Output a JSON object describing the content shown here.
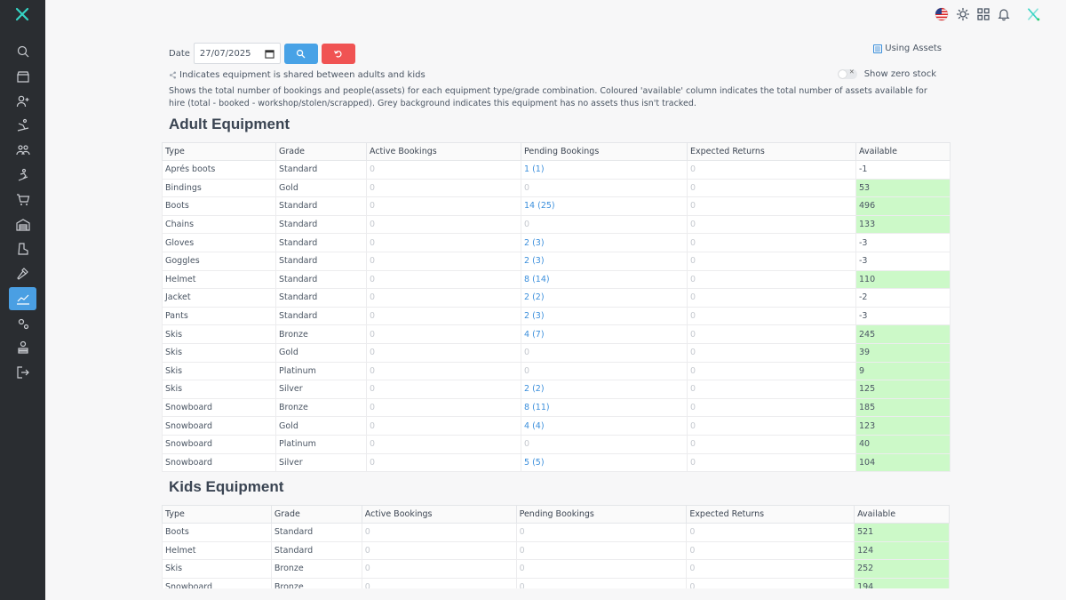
{
  "topbar": {
    "icons": [
      "us-flag-icon",
      "sun-icon",
      "grid-icon",
      "bell-icon",
      "brand-logo-icon"
    ]
  },
  "sidebar": {
    "items": [
      {
        "name": "search-icon"
      },
      {
        "name": "shop-icon"
      },
      {
        "name": "add-user-icon"
      },
      {
        "name": "skier-icon"
      },
      {
        "name": "group-icon"
      },
      {
        "name": "snowboarder-icon"
      },
      {
        "name": "cart-icon"
      },
      {
        "name": "warehouse-icon"
      },
      {
        "name": "boot-icon"
      },
      {
        "name": "hammer-icon"
      },
      {
        "name": "chart-icon",
        "active": true
      },
      {
        "name": "settings-icon"
      },
      {
        "name": "user-stack-icon"
      },
      {
        "name": "logout-icon"
      }
    ]
  },
  "filter": {
    "date_label": "Date",
    "date_value": "27/07/2025"
  },
  "using_assets": {
    "icon_text": "▥",
    "label": "Using Assets"
  },
  "shared_note": "Indicates equipment is shared between adults and kids",
  "zero_stock": {
    "label": "Show zero stock",
    "toggle_mark": "✕"
  },
  "description": "Shows the total number of bookings and people(assets) for each equipment type/grade combination. Coloured 'available' column indicates the total number of assets available for hire (total - booked - workshop/stolen/scrapped). Grey background indicates this equipment has no assets thus isn't tracked.",
  "adult": {
    "title": "Adult Equipment",
    "columns": [
      "Type",
      "Grade",
      "Active Bookings",
      "Pending Bookings",
      "Expected Returns",
      "Available"
    ],
    "rows": [
      {
        "type": "Aprés boots",
        "grade": "Standard",
        "active": "0",
        "pending": "1 (1)",
        "returns": "0",
        "available": "-1"
      },
      {
        "type": "Bindings",
        "grade": "Gold",
        "active": "0",
        "pending": "0",
        "returns": "0",
        "available": "53"
      },
      {
        "type": "Boots",
        "grade": "Standard",
        "active": "0",
        "pending": "14 (25)",
        "returns": "0",
        "available": "496"
      },
      {
        "type": "Chains",
        "grade": "Standard",
        "active": "0",
        "pending": "0",
        "returns": "0",
        "available": "133"
      },
      {
        "type": "Gloves",
        "grade": "Standard",
        "active": "0",
        "pending": "2 (3)",
        "returns": "0",
        "available": "-3"
      },
      {
        "type": "Goggles",
        "grade": "Standard",
        "active": "0",
        "pending": "2 (3)",
        "returns": "0",
        "available": "-3"
      },
      {
        "type": "Helmet",
        "grade": "Standard",
        "active": "0",
        "pending": "8 (14)",
        "returns": "0",
        "available": "110"
      },
      {
        "type": "Jacket",
        "grade": "Standard",
        "active": "0",
        "pending": "2 (2)",
        "returns": "0",
        "available": "-2"
      },
      {
        "type": "Pants",
        "grade": "Standard",
        "active": "0",
        "pending": "2 (3)",
        "returns": "0",
        "available": "-3"
      },
      {
        "type": "Skis",
        "grade": "Bronze",
        "active": "0",
        "pending": "4 (7)",
        "returns": "0",
        "available": "245"
      },
      {
        "type": "Skis",
        "grade": "Gold",
        "active": "0",
        "pending": "0",
        "returns": "0",
        "available": "39"
      },
      {
        "type": "Skis",
        "grade": "Platinum",
        "active": "0",
        "pending": "0",
        "returns": "0",
        "available": "9"
      },
      {
        "type": "Skis",
        "grade": "Silver",
        "active": "0",
        "pending": "2 (2)",
        "returns": "0",
        "available": "125"
      },
      {
        "type": "Snowboard",
        "grade": "Bronze",
        "active": "0",
        "pending": "8 (11)",
        "returns": "0",
        "available": "185"
      },
      {
        "type": "Snowboard",
        "grade": "Gold",
        "active": "0",
        "pending": "4 (4)",
        "returns": "0",
        "available": "123"
      },
      {
        "type": "Snowboard",
        "grade": "Platinum",
        "active": "0",
        "pending": "0",
        "returns": "0",
        "available": "40"
      },
      {
        "type": "Snowboard",
        "grade": "Silver",
        "active": "0",
        "pending": "5 (5)",
        "returns": "0",
        "available": "104"
      }
    ]
  },
  "kids": {
    "title": "Kids Equipment",
    "columns": [
      "Type",
      "Grade",
      "Active Bookings",
      "Pending Bookings",
      "Expected Returns",
      "Available"
    ],
    "rows": [
      {
        "type": "Boots",
        "grade": "Standard",
        "active": "0",
        "pending": "0",
        "returns": "0",
        "available": "521"
      },
      {
        "type": "Helmet",
        "grade": "Standard",
        "active": "0",
        "pending": "0",
        "returns": "0",
        "available": "124"
      },
      {
        "type": "Skis",
        "grade": "Bronze",
        "active": "0",
        "pending": "0",
        "returns": "0",
        "available": "252"
      },
      {
        "type": "Snowboard",
        "grade": "Bronze",
        "active": "0",
        "pending": "0",
        "returns": "0",
        "available": "194"
      }
    ]
  }
}
